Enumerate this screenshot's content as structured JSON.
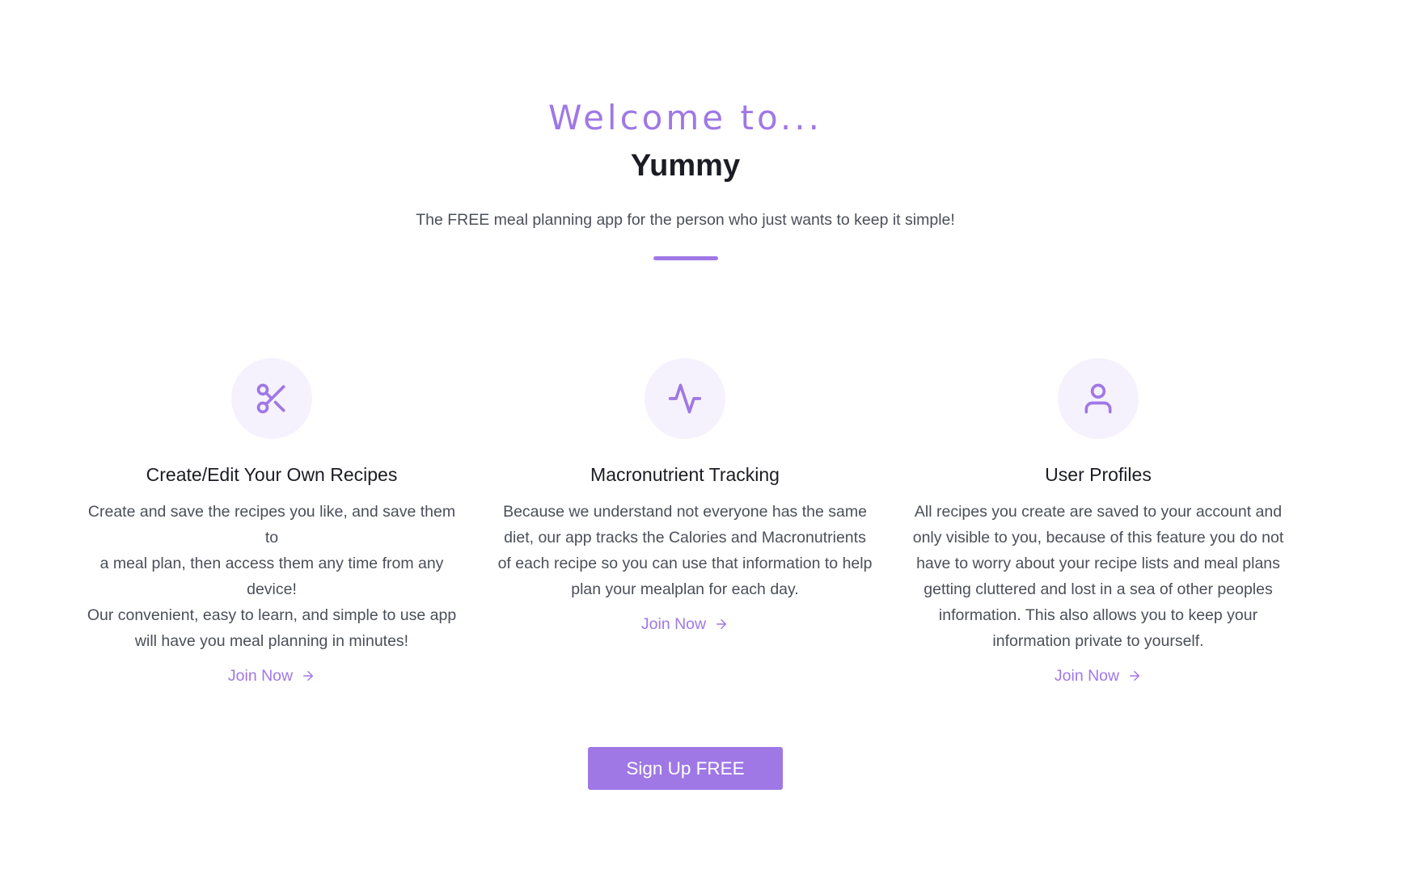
{
  "hero": {
    "welcome": "Welcome to...",
    "brand": "Yummy",
    "tagline": "The FREE meal planning app for the person who just wants to keep it simple!"
  },
  "accent_color": "#9f78e6",
  "features": [
    {
      "icon": "scissors-icon",
      "title": "Create/Edit Your Own Recipes",
      "description_lines": [
        "Create and save the recipes you like, and save them to",
        "a meal plan, then access them any time from any",
        "device!",
        "Our convenient, easy to learn, and simple to use app",
        "will have you meal planning in minutes!"
      ],
      "link": "Join Now"
    },
    {
      "icon": "activity-icon",
      "title": "Macronutrient Tracking",
      "description_lines": [
        "Because we understand not everyone has the same",
        "diet, our app tracks the Calories and Macronutrients",
        "of each recipe so you can use that information to help",
        "plan your mealplan for each day."
      ],
      "link": "Join Now"
    },
    {
      "icon": "user-icon",
      "title": "User Profiles",
      "description_lines": [
        "All recipes you create are saved to your account and",
        "only visible to you, because of this feature you do not",
        "have to worry about your recipe lists and meal plans",
        "getting cluttered and lost in a sea of other peoples",
        "information. This also allows you to keep your",
        "information private to yourself."
      ],
      "link": "Join Now"
    }
  ],
  "cta": {
    "label": "Sign Up FREE"
  }
}
